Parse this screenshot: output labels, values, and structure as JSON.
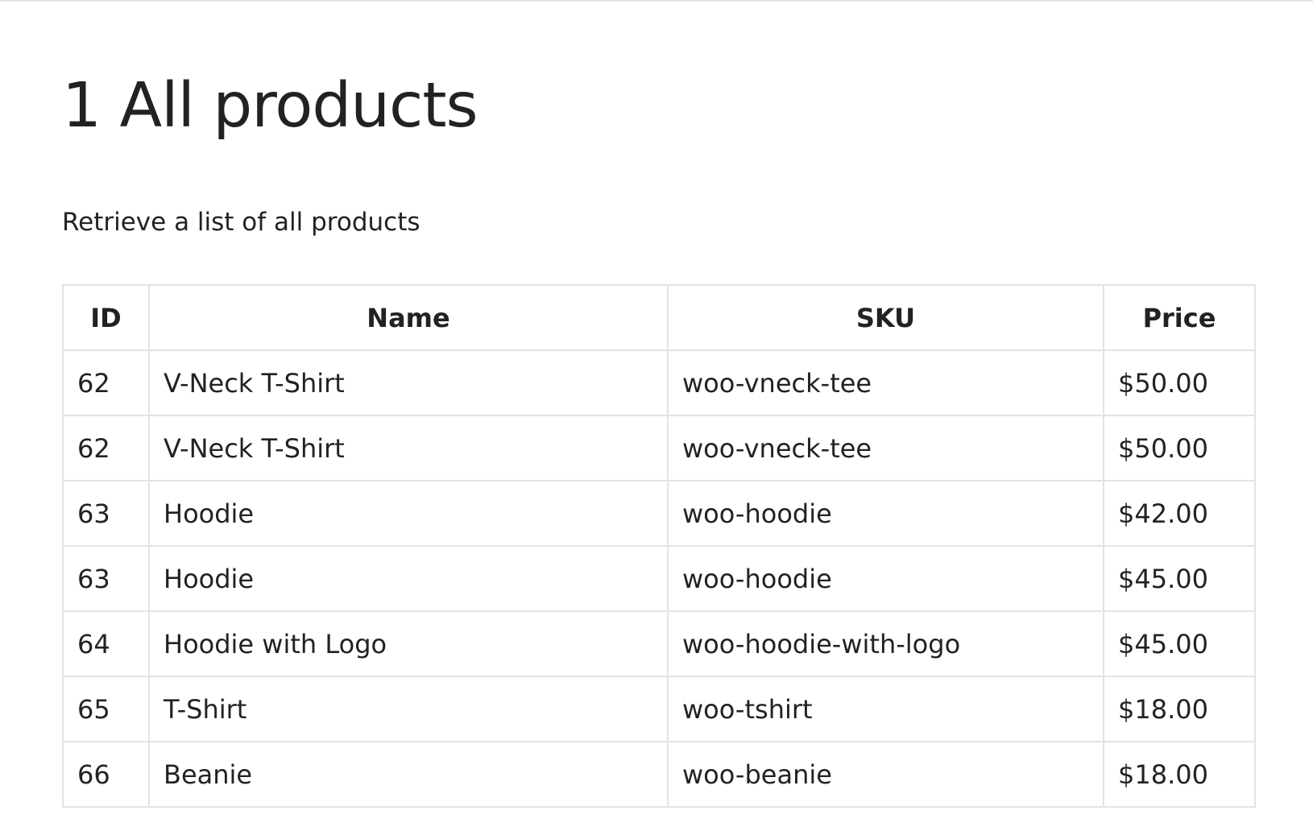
{
  "page": {
    "title": "1 All products",
    "description": "Retrieve a list of all products"
  },
  "table": {
    "headers": {
      "id": "ID",
      "name": "Name",
      "sku": "SKU",
      "price": "Price"
    },
    "rows": [
      {
        "id": "62",
        "name": "V-Neck T-Shirt",
        "sku": "woo-vneck-tee",
        "price": "$50.00"
      },
      {
        "id": "62",
        "name": "V-Neck T-Shirt",
        "sku": "woo-vneck-tee",
        "price": "$50.00"
      },
      {
        "id": "63",
        "name": "Hoodie",
        "sku": "woo-hoodie",
        "price": "$42.00"
      },
      {
        "id": "63",
        "name": "Hoodie",
        "sku": "woo-hoodie",
        "price": "$45.00"
      },
      {
        "id": "64",
        "name": "Hoodie with Logo",
        "sku": "woo-hoodie-with-logo",
        "price": "$45.00"
      },
      {
        "id": "65",
        "name": "T-Shirt",
        "sku": "woo-tshirt",
        "price": "$18.00"
      },
      {
        "id": "66",
        "name": "Beanie",
        "sku": "woo-beanie",
        "price": "$18.00"
      }
    ]
  }
}
